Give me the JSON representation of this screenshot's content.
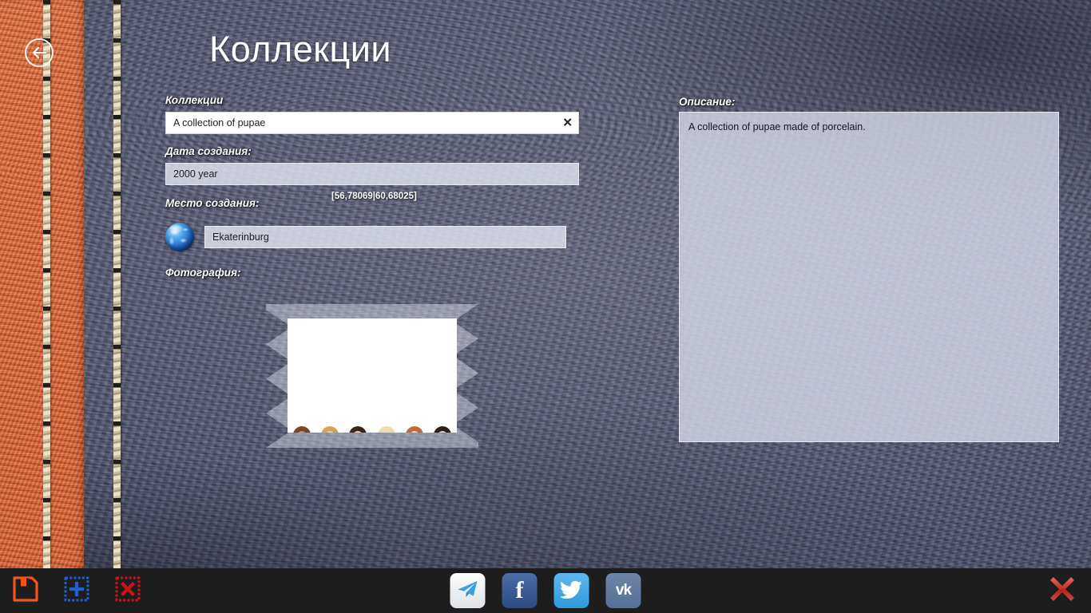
{
  "header": {
    "title": "Коллекции",
    "back_icon": "back-arrow-circle-icon"
  },
  "form": {
    "collection_label": "Коллекции",
    "collection_value": "A collection of pupae",
    "collection_clear_icon": "✕",
    "date_label": "Дата создания:",
    "date_value": "2000 year",
    "place_label": "Место создания:",
    "coordinates": "[56,78069|60,68025]",
    "place_value": "Ekaterinburg",
    "globe_icon": "globe-icon",
    "photo_label": "Фотография:"
  },
  "description": {
    "label": "Описание:",
    "text": "A collection of pupae made of porcelain."
  },
  "appbar": {
    "save_icon": "floppy-save-icon",
    "add_icon": "add-photo-icon",
    "delete_icon": "delete-photo-icon",
    "telegram_icon": "telegram-icon",
    "facebook_icon": "facebook-icon",
    "facebook_label": "f",
    "twitter_icon": "twitter-icon",
    "vk_icon": "vk-icon",
    "vk_label": "vk",
    "close_icon": "close-x-icon"
  },
  "colors": {
    "orange_spine": "#f06a32",
    "leather_blue": "#5c6080",
    "save_orange": "#f2541b",
    "add_blue": "#1f5fd0",
    "delete_red": "#cc1418",
    "close_red": "#d43a36",
    "facebook_blue": "#3b5998",
    "twitter_blue": "#3fa9e0",
    "vk_blue": "#5d7596",
    "field_white": "#ffffff",
    "field_frost": "#e2e5f0"
  },
  "photo": {
    "alt": "collection-of-dolls-photo",
    "dolls": [
      {
        "hair": "#7a4b2c",
        "hair2": "#53301b",
        "dress": "#f6b9c6",
        "dress2": "#ec94aa",
        "skin": "#c98f64"
      },
      {
        "hair": "#d9a858",
        "hair2": "#b6843a",
        "dress": "#e8f2b6",
        "dress2": "#c9e07e",
        "skin": "#f0c9a4"
      },
      {
        "hair": "#3d2a1e",
        "hair2": "#241710",
        "dress": "#8ea3d6",
        "dress2": "#2e3f78",
        "skin": "#f2cdac"
      },
      {
        "hair": "#efe0b4",
        "hair2": "#dcc98c",
        "dress": "#f0879e",
        "dress2": "#e4627f",
        "skin": "#f7dcc2"
      },
      {
        "hair": "#c4703a",
        "hair2": "#9e5125",
        "dress": "#f4e2ea",
        "dress2": "#e9c3d4",
        "skin": "#f3cfae"
      },
      {
        "hair": "#30231c",
        "hair2": "#1b1210",
        "dress": "#f7c3cf",
        "dress2": "#eda6b8",
        "skin": "#f2cdb0"
      }
    ]
  }
}
